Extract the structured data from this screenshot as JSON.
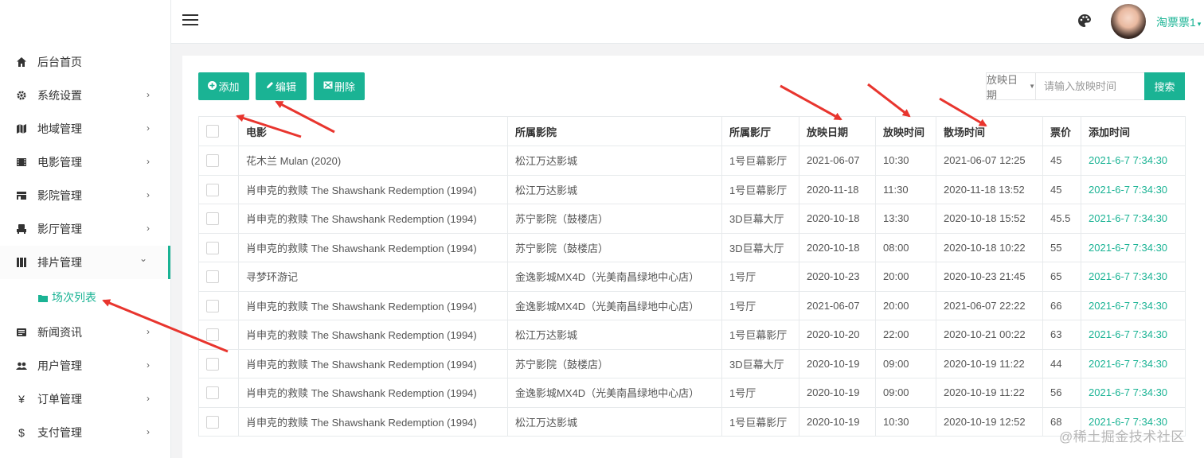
{
  "sidebar": {
    "items": [
      {
        "label": "后台首页",
        "icon": "home-icon",
        "has_arrow": false
      },
      {
        "label": "系统设置",
        "icon": "gear-icon",
        "has_arrow": true
      },
      {
        "label": "地域管理",
        "icon": "map-icon",
        "has_arrow": true
      },
      {
        "label": "电影管理",
        "icon": "film-icon",
        "has_arrow": true
      },
      {
        "label": "影院管理",
        "icon": "building-icon",
        "has_arrow": true
      },
      {
        "label": "影厅管理",
        "icon": "seat-icon",
        "has_arrow": true
      },
      {
        "label": "排片管理",
        "icon": "schedule-icon",
        "has_arrow": true,
        "expanded": true
      },
      {
        "label": "新闻资讯",
        "icon": "news-icon",
        "has_arrow": true
      },
      {
        "label": "用户管理",
        "icon": "users-icon",
        "has_arrow": true
      },
      {
        "label": "订单管理",
        "icon": "yen-icon",
        "has_arrow": true
      },
      {
        "label": "支付管理",
        "icon": "dollar-icon",
        "has_arrow": true
      }
    ],
    "sub_item": {
      "label": "场次列表",
      "icon": "folder-icon"
    },
    "arrow_glyph": "›",
    "expanded_glyph": "⌄"
  },
  "topbar": {
    "username": "淘票票1",
    "icons": [
      "menu-icon",
      "palette-icon"
    ]
  },
  "toolbar": {
    "add_label": "添加",
    "edit_label": "编辑",
    "delete_label": "删除",
    "filter_select": "放映日期",
    "search_placeholder": "请输入放映时间",
    "search_label": "搜索"
  },
  "table": {
    "headers": [
      "电影",
      "所属影院",
      "所属影厅",
      "放映日期",
      "放映时间",
      "散场时间",
      "票价",
      "添加时间"
    ],
    "rows": [
      [
        "花木兰 Mulan (2020)",
        "松江万达影城",
        "1号巨幕影厅",
        "2021-06-07",
        "10:30",
        "2021-06-07 12:25",
        "45",
        "2021-6-7 7:34:30"
      ],
      [
        "肖申克的救赎 The Shawshank Redemption (1994)",
        "松江万达影城",
        "1号巨幕影厅",
        "2020-11-18",
        "11:30",
        "2020-11-18 13:52",
        "45",
        "2021-6-7 7:34:30"
      ],
      [
        "肖申克的救赎 The Shawshank Redemption (1994)",
        "苏宁影院（鼓楼店）",
        "3D巨幕大厅",
        "2020-10-18",
        "13:30",
        "2020-10-18 15:52",
        "45.5",
        "2021-6-7 7:34:30"
      ],
      [
        "肖申克的救赎 The Shawshank Redemption (1994)",
        "苏宁影院（鼓楼店）",
        "3D巨幕大厅",
        "2020-10-18",
        "08:00",
        "2020-10-18 10:22",
        "55",
        "2021-6-7 7:34:30"
      ],
      [
        "寻梦环游记",
        "金逸影城MX4D（光美南昌绿地中心店）",
        "1号厅",
        "2020-10-23",
        "20:00",
        "2020-10-23 21:45",
        "65",
        "2021-6-7 7:34:30"
      ],
      [
        "肖申克的救赎 The Shawshank Redemption (1994)",
        "金逸影城MX4D（光美南昌绿地中心店）",
        "1号厅",
        "2021-06-07",
        "20:00",
        "2021-06-07 22:22",
        "66",
        "2021-6-7 7:34:30"
      ],
      [
        "肖申克的救赎 The Shawshank Redemption (1994)",
        "松江万达影城",
        "1号巨幕影厅",
        "2020-10-20",
        "22:00",
        "2020-10-21 00:22",
        "63",
        "2021-6-7 7:34:30"
      ],
      [
        "肖申克的救赎 The Shawshank Redemption (1994)",
        "苏宁影院（鼓楼店）",
        "3D巨幕大厅",
        "2020-10-19",
        "09:00",
        "2020-10-19 11:22",
        "44",
        "2021-6-7 7:34:30"
      ],
      [
        "肖申克的救赎 The Shawshank Redemption (1994)",
        "金逸影城MX4D（光美南昌绿地中心店）",
        "1号厅",
        "2020-10-19",
        "09:00",
        "2020-10-19 11:22",
        "56",
        "2021-6-7 7:34:30"
      ],
      [
        "肖申克的救赎 The Shawshank Redemption (1994)",
        "松江万达影城",
        "1号巨幕影厅",
        "2020-10-19",
        "10:30",
        "2020-10-19 12:52",
        "68",
        "2021-6-7 7:34:30"
      ]
    ]
  },
  "watermark": "@稀土掘金技术社区",
  "colors": {
    "accent": "#1ab394",
    "annotation_arrow": "#e8352e"
  }
}
